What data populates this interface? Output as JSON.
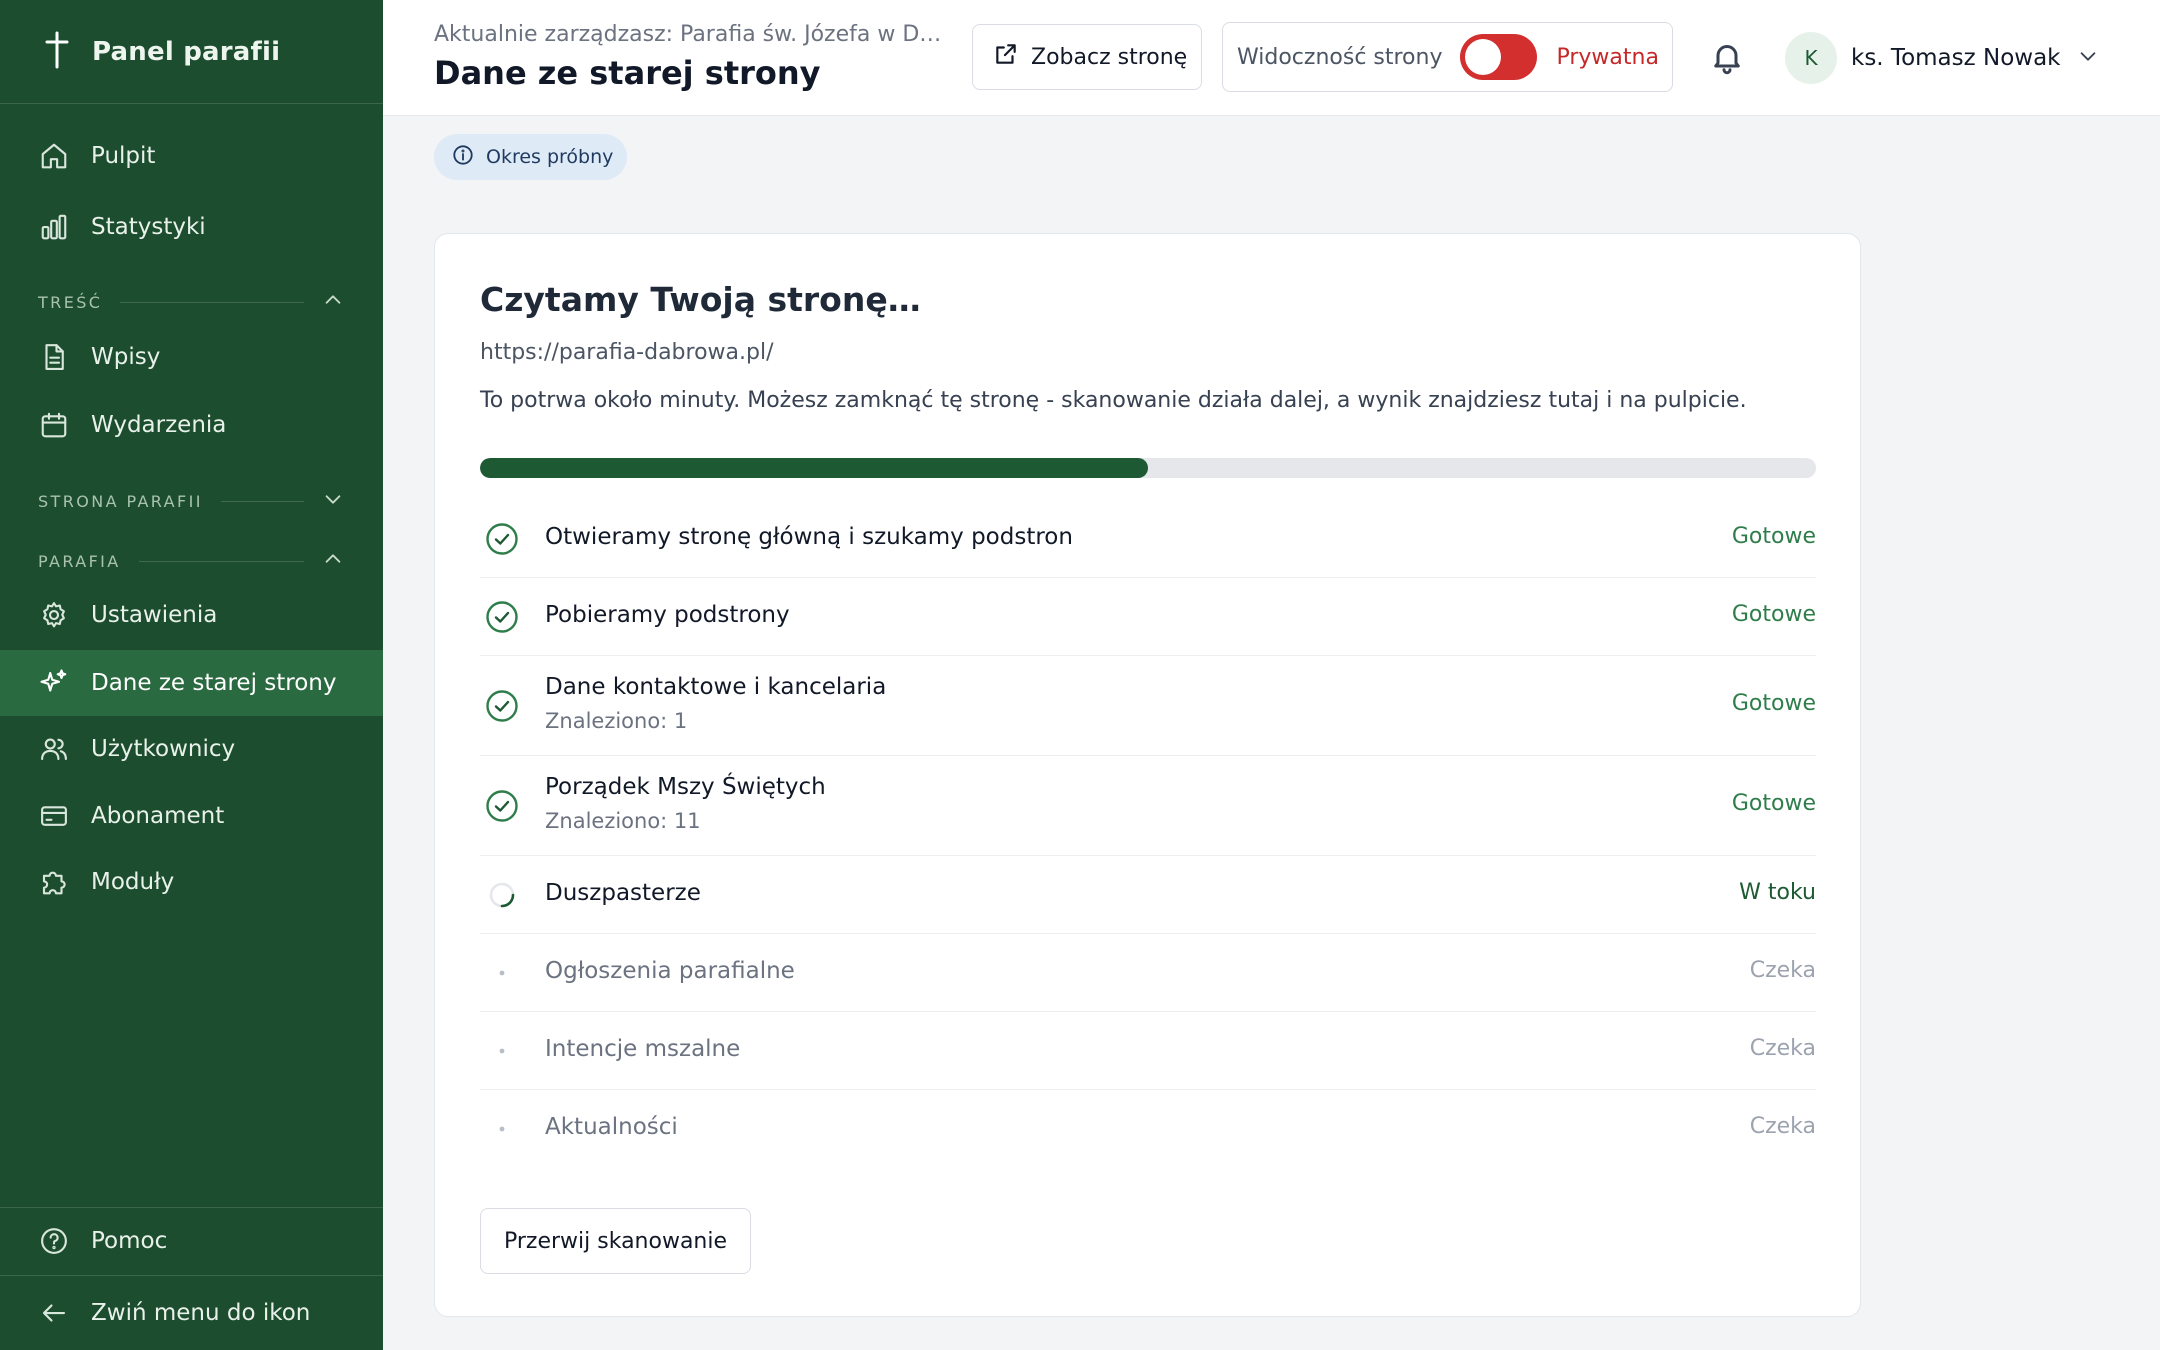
{
  "sidebar": {
    "brand": "Panel parafii",
    "items": {
      "pulpit": "Pulpit",
      "statystyki": "Statystyki",
      "wpisy": "Wpisy",
      "wydarzenia": "Wydarzenia",
      "ustawienia": "Ustawienia",
      "dane": "Dane ze starej strony",
      "uzytkownicy": "Użytkownicy",
      "abonament": "Abonament",
      "moduly": "Moduły",
      "pomoc": "Pomoc",
      "collapse": "Zwiń menu do ikon"
    },
    "sections": {
      "tresc": "TREŚĆ",
      "strona": "STRONA PARAFII",
      "parafia": "PARAFIA"
    }
  },
  "header": {
    "breadcrumb": "Aktualnie zarządzasz: Parafia św. Józefa w Dąbrowie",
    "title": "Dane ze starej strony",
    "view_site": "Zobacz stronę",
    "visibility_label": "Widoczność strony",
    "visibility_state": "Prywatna",
    "user_initial": "K",
    "user_name": "ks. Tomasz Nowak"
  },
  "trial_badge": "Okres próbny",
  "scan": {
    "title": "Czytamy Twoją stronę…",
    "url": "https://parafia-dabrowa.pl/",
    "description": "To potrwa około minuty. Możesz zamknąć tę stronę - skanowanie działa dalej, a wynik znajdziesz tutaj i na pulpicie.",
    "progress": 0.5,
    "steps": [
      {
        "label": "Otwieramy stronę główną i szukamy podstron",
        "sub": "",
        "status": "Gotowe"
      },
      {
        "label": "Pobieramy podstrony",
        "sub": "",
        "status": "Gotowe"
      },
      {
        "label": "Dane kontaktowe i kancelaria",
        "sub": "Znaleziono: 1",
        "status": "Gotowe"
      },
      {
        "label": "Porządek Mszy Świętych",
        "sub": "Znaleziono: 11",
        "status": "Gotowe"
      },
      {
        "label": "Duszpasterze",
        "sub": "",
        "status": "W toku"
      },
      {
        "label": "Ogłoszenia parafialne",
        "sub": "",
        "status": "Czeka"
      },
      {
        "label": "Intencje mszalne",
        "sub": "",
        "status": "Czeka"
      },
      {
        "label": "Aktualności",
        "sub": "",
        "status": "Czeka"
      }
    ],
    "stop_button": "Przerwij skanowanie"
  },
  "colors": {
    "sidebar_bg": "#1d4d2f",
    "sidebar_active": "#2a6a40",
    "accent_green": "#1d5a33",
    "done_green": "#2e7d4a",
    "private_red": "#d32f2f"
  }
}
